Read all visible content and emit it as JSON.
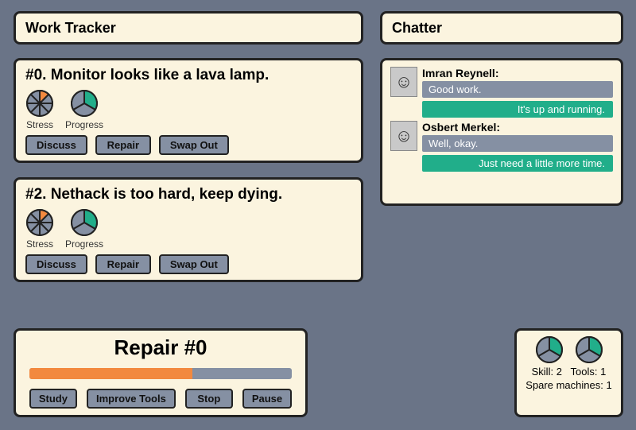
{
  "work_tracker": {
    "title": "Work Tracker",
    "tickets": [
      {
        "id": "0",
        "title": "#0. Monitor looks like a lava lamp.",
        "stress_label": "Stress",
        "progress_label": "Progress",
        "stress_slices": [
          "#f2893f",
          "#8590a3",
          "#8590a3",
          "#8590a3",
          "#8590a3",
          "#8590a3",
          "#8590a3",
          "#8590a3"
        ],
        "progress_slices": [
          "#21ae8a",
          "#8590a3",
          "#8590a3"
        ],
        "buttons": {
          "discuss": "Discuss",
          "repair": "Repair",
          "swap": "Swap Out"
        }
      },
      {
        "id": "2",
        "title": "#2. Nethack is too hard, keep dying.",
        "stress_label": "Stress",
        "progress_label": "Progress",
        "stress_slices": [
          "#f2893f",
          "#8590a3",
          "#8590a3",
          "#8590a3",
          "#8590a3",
          "#8590a3",
          "#8590a3",
          "#8590a3"
        ],
        "progress_slices": [
          "#21ae8a",
          "#8590a3",
          "#8590a3"
        ],
        "buttons": {
          "discuss": "Discuss",
          "repair": "Repair",
          "swap": "Swap Out"
        }
      }
    ]
  },
  "chatter": {
    "title": "Chatter",
    "threads": [
      {
        "name": "Imran Reynell:",
        "their_msg": "Good work.",
        "my_msg": "It's up and running."
      },
      {
        "name": "Osbert Merkel:",
        "their_msg": "Well, okay.",
        "my_msg": "Just need a little more time."
      }
    ]
  },
  "repair": {
    "title": "Repair #0",
    "progress_percent": 62,
    "buttons": {
      "study": "Study",
      "improve": "Improve Tools",
      "stop": "Stop",
      "pause": "Pause"
    }
  },
  "stats": {
    "skill_label": "Skill:",
    "skill_value": "2",
    "skill_slices": [
      "#21ae8a",
      "#8590a3",
      "#8590a3"
    ],
    "tools_label": "Tools:",
    "tools_value": "1",
    "tools_slices": [
      "#21ae8a",
      "#8590a3",
      "#8590a3"
    ],
    "spare_label": "Spare machines:",
    "spare_value": "1"
  },
  "chart_data": [
    {
      "type": "pie",
      "title": "Ticket #0 Stress",
      "categories": [
        "filled",
        "empty",
        "empty",
        "empty",
        "empty",
        "empty",
        "empty",
        "empty"
      ],
      "values": [
        1,
        1,
        1,
        1,
        1,
        1,
        1,
        1
      ]
    },
    {
      "type": "pie",
      "title": "Ticket #0 Progress",
      "categories": [
        "done",
        "todo",
        "todo"
      ],
      "values": [
        1,
        1,
        1
      ]
    },
    {
      "type": "pie",
      "title": "Ticket #2 Stress",
      "categories": [
        "filled",
        "empty",
        "empty",
        "empty",
        "empty",
        "empty",
        "empty",
        "empty"
      ],
      "values": [
        1,
        1,
        1,
        1,
        1,
        1,
        1,
        1
      ]
    },
    {
      "type": "pie",
      "title": "Ticket #2 Progress",
      "categories": [
        "done",
        "todo",
        "todo"
      ],
      "values": [
        1,
        1,
        1
      ]
    },
    {
      "type": "pie",
      "title": "Skill",
      "categories": [
        "filled",
        "empty",
        "empty"
      ],
      "values": [
        1,
        1,
        1
      ]
    },
    {
      "type": "pie",
      "title": "Tools",
      "categories": [
        "filled",
        "empty",
        "empty"
      ],
      "values": [
        1,
        1,
        1
      ]
    },
    {
      "type": "bar",
      "title": "Repair #0 progress",
      "categories": [
        "progress"
      ],
      "values": [
        62
      ],
      "ylim": [
        0,
        100
      ]
    }
  ]
}
